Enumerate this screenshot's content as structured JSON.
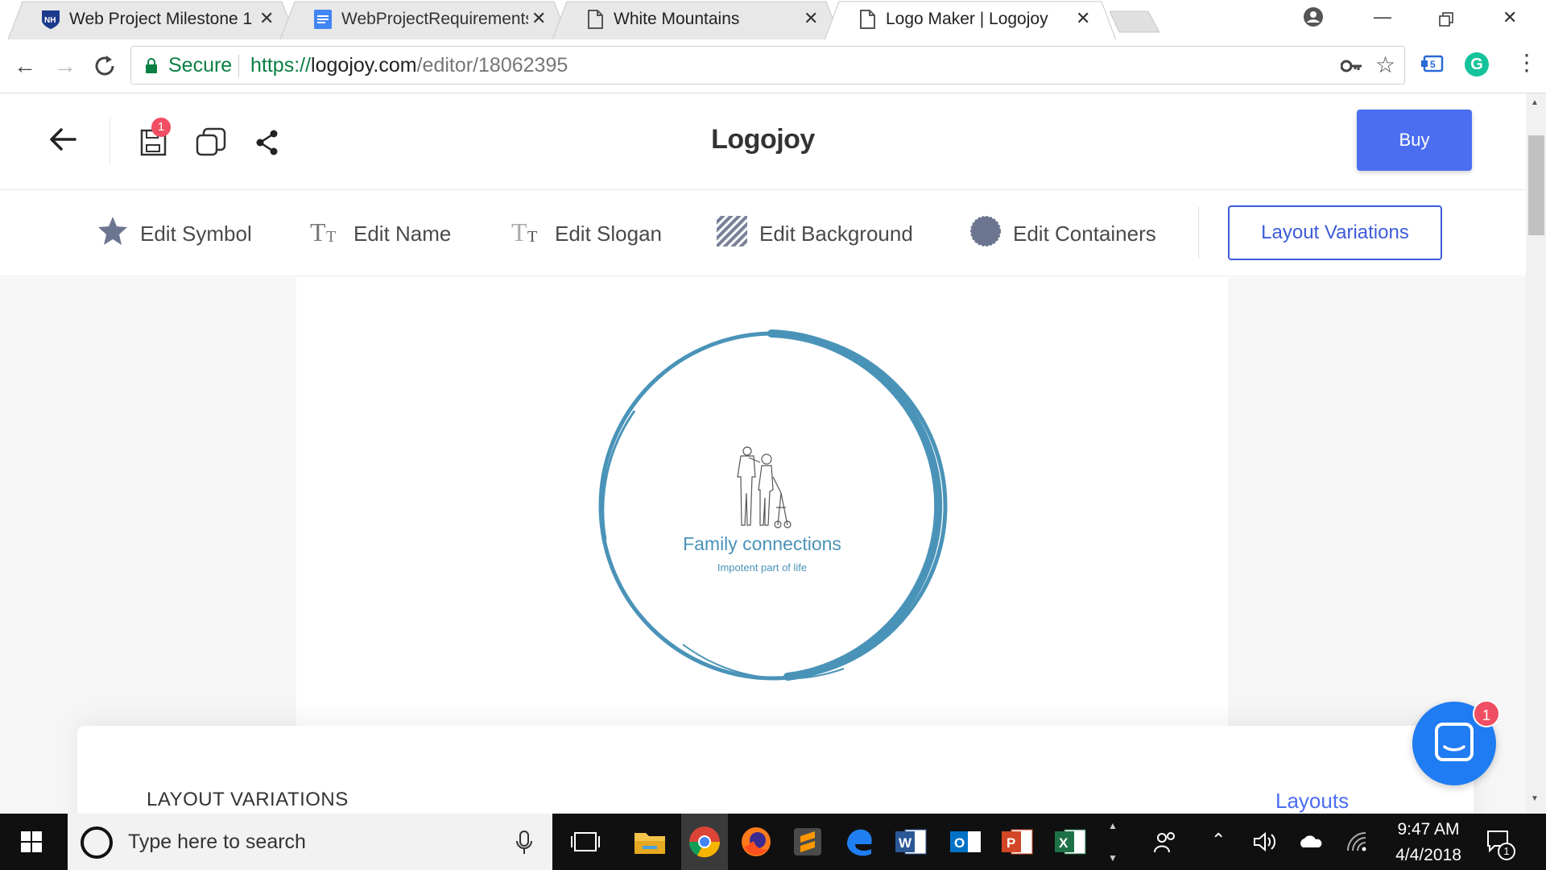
{
  "browser": {
    "tabs": [
      {
        "title": "Web Project Milestone 1",
        "icon": "unh-logo-icon",
        "active": false
      },
      {
        "title": "WebProjectRequirements",
        "icon": "google-docs-icon",
        "active": false
      },
      {
        "title": "White Mountains",
        "icon": "document-icon",
        "active": false
      },
      {
        "title": "Logo Maker | Logojoy",
        "icon": "document-icon",
        "active": true
      }
    ],
    "secure_label": "Secure",
    "url_scheme": "https://",
    "url_host": "logojoy.com",
    "url_path": "/editor/18062395"
  },
  "app": {
    "brand": "Logojoy",
    "buy_label": "Buy",
    "save_badge": "1",
    "toolbar": {
      "edit_symbol": "Edit Symbol",
      "edit_name": "Edit Name",
      "edit_slogan": "Edit Slogan",
      "edit_background": "Edit Background",
      "edit_containers": "Edit Containers",
      "layout_variations": "Layout Variations"
    },
    "logo": {
      "name": "Family connections",
      "slogan": "Impotent part of life",
      "accent_color": "#4a93b8"
    },
    "panel": {
      "title": "LAYOUT VARIATIONS",
      "layouts_link": "Layouts"
    },
    "chat_badge": "1"
  },
  "taskbar": {
    "search_placeholder": "Type here to search",
    "time": "9:47 AM",
    "date": "4/4/2018",
    "notification_count": "1"
  },
  "colors": {
    "primary_blue": "#4b6ef0",
    "secure_green": "#0b8043",
    "taskbar_bg": "#101010"
  }
}
